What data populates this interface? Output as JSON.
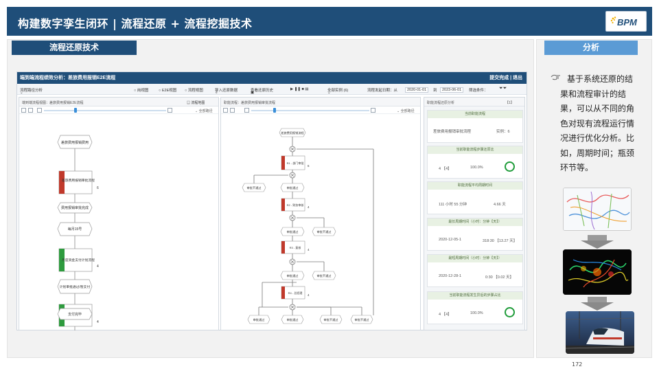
{
  "header": {
    "title": "构建数字孪生闭环 |  流程还原 + 流程挖掘技术",
    "logo_text": "BPM",
    "logo_color": "#1f4e79"
  },
  "left": {
    "tab_label": "流程还原技术"
  },
  "right": {
    "tab_label": "分析",
    "text": "基于系统还原的结果和流程审计的结果，可以从不同的角色对现有流程运行情况进行优化分析。比如，周期时间；瓶颈环节等。",
    "icons": [
      "hand-pointer-icon",
      "route-map-image",
      "heatmap-image",
      "train-image",
      "down-arrow-icon"
    ]
  },
  "page_number": "172",
  "app": {
    "title": "端到端流程绩效分析：差旅费用报销E2E流程",
    "top_actions": "提交完成  |  退出",
    "toolbar": {
      "breadcrumb": "流程路径分析",
      "view1": "○ 岗视图",
      "view2": "○ E2E视图",
      "view3": "○ 流程视图",
      "import": "导入还原数据",
      "history": "查看还原历史",
      "all_instances": "全部实例 (6)",
      "start_label": "流程发起日期：从",
      "date_from": "2020-01-01",
      "to": "到",
      "date_to": "2023-06-01",
      "filter": "筛选条件："
    },
    "panel1": {
      "head": "端到端流程视图：差旅费用报销E2E流程",
      "map_btn": "流程地图",
      "filter": "全部路径",
      "nodes": [
        "差旅费用报销费用",
        "差旅费用报销审批流程",
        "费用报销审批完成",
        "每月15号",
        "月度资金支付计划流程",
        "计划审批通过/暂支付",
        "月度资金支付流程",
        "支付完毕"
      ],
      "counts": [
        "6",
        "4",
        "4"
      ]
    },
    "panel2": {
      "head": "职能流程：差旅费用报销审批流程",
      "filter": "全部路径",
      "nodes": [
        "差旅费用报销流程",
        "部门审批",
        "财务审核",
        "审批通过",
        "审批不通过",
        "财务初审",
        "审批通过",
        "审批不通过",
        "审批通过",
        "审批不通过",
        "审批通过",
        "审批通过",
        "审批不通过",
        "审批不通过"
      ],
      "red_tags": [
        "R1 - 部门审批",
        "R2 - 财务审核",
        "R3 - 复核",
        "R4 - 总经理"
      ],
      "counts": [
        "6",
        "4",
        "4",
        "4"
      ]
    },
    "panel3": {
      "head": "职能流程还原分析",
      "badge": "【1】",
      "cards": [
        {
          "title": "当前职能流程",
          "v1": "差旅费用报销审批流程",
          "v2": "实例：6"
        },
        {
          "title": "当前职能流程步骤还原比",
          "v1": "4 【4】",
          "v2": "100.0%"
        },
        {
          "title": "职能流程平均周期时间",
          "v1": "111 小时 55 分钟",
          "v2": "4.66 天"
        },
        {
          "title": "最长周期时间（小时：分钟【天】）",
          "v1": "2020-12-05-1",
          "v2": "318:30 【13.27 天】"
        },
        {
          "title": "最短周期时间（小时：分钟【天】）",
          "v1": "2020-12-28-1",
          "v2": "0:30 【0.02 天】"
        },
        {
          "title": "当前职能流程发生异后的步骤占比",
          "v1": "4 【4】",
          "v2": "100.0%"
        }
      ]
    }
  }
}
